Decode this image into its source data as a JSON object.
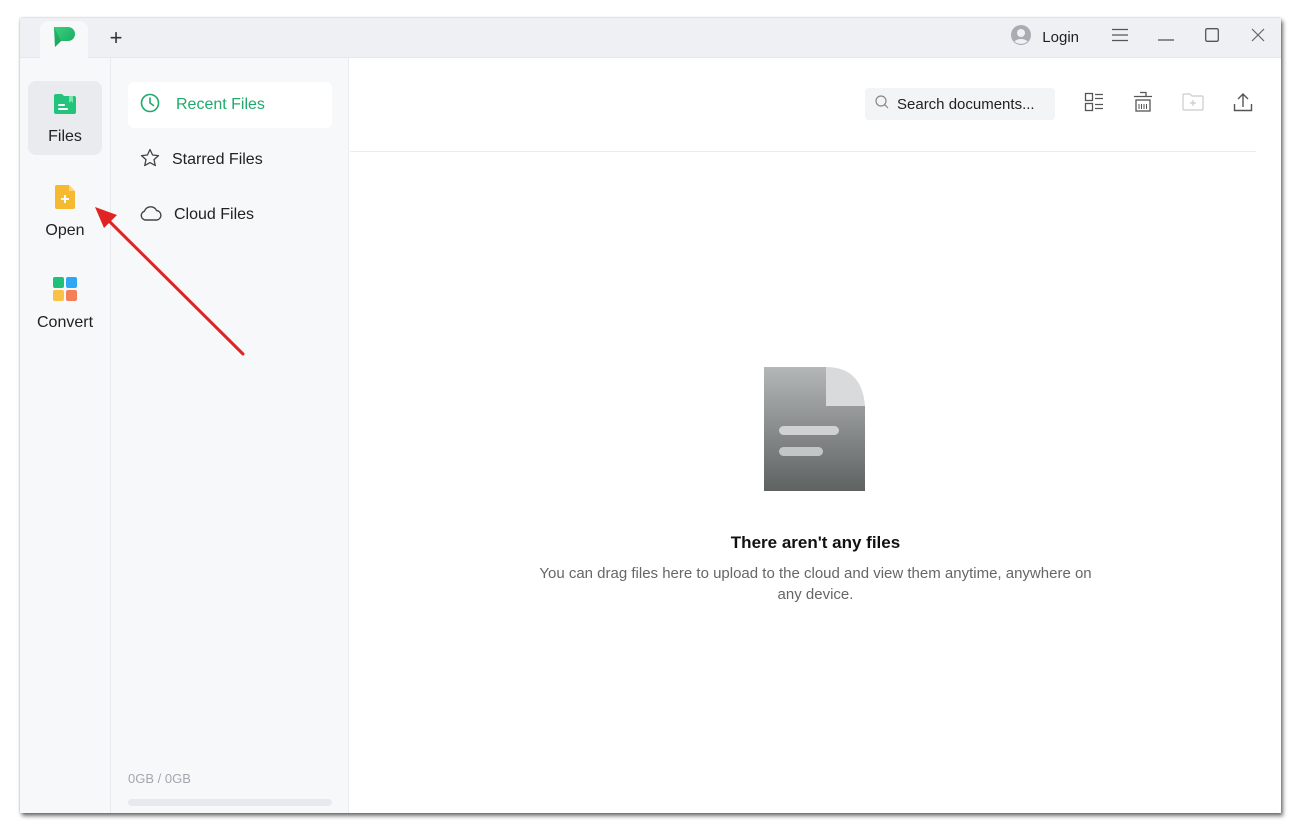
{
  "titlebar": {
    "app_tab_icon": "app-logo-icon",
    "add_tab_label": "+",
    "login_label": "Login",
    "controls": [
      "menu-icon",
      "minimize-icon",
      "maximize-icon",
      "close-icon"
    ]
  },
  "rail": {
    "items": [
      {
        "label": "Files",
        "icon": "files-folder-icon",
        "active": true
      },
      {
        "label": "Open",
        "icon": "open-file-icon",
        "active": false
      },
      {
        "label": "Convert",
        "icon": "convert-grid-icon",
        "active": false
      }
    ]
  },
  "panel": {
    "items": [
      {
        "label": "Recent Files",
        "icon": "clock-icon",
        "active": true
      },
      {
        "label": "Starred Files",
        "icon": "star-icon",
        "active": false
      },
      {
        "label": "Cloud Files",
        "icon": "cloud-icon",
        "active": false
      }
    ],
    "storage": {
      "text": "0GB / 0GB",
      "used_fraction": 0
    }
  },
  "toolbar": {
    "search_placeholder": "Search documents...",
    "icons": [
      "list-view-icon",
      "trash-icon",
      "new-folder-icon",
      "upload-icon"
    ]
  },
  "empty_state": {
    "title": "There aren't any files",
    "description": "You can drag files here to upload to the cloud and view them anytime, anywhere on any device."
  },
  "colors": {
    "accent": "#1faa6b",
    "annotation_arrow": "#e02424"
  }
}
